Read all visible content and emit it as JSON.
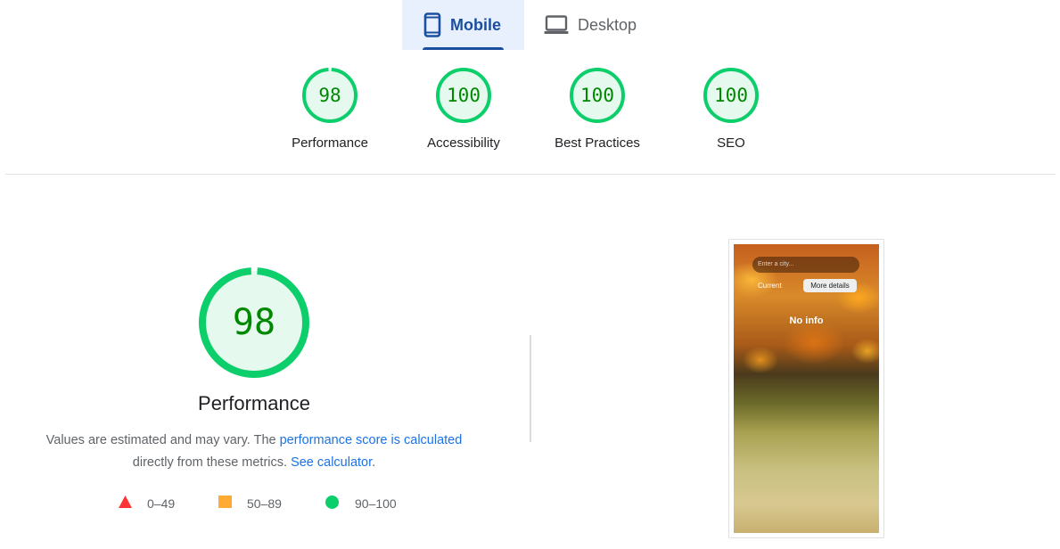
{
  "tabs": [
    {
      "label": "Mobile",
      "icon": "phone-icon",
      "active": true
    },
    {
      "label": "Desktop",
      "icon": "laptop-icon",
      "active": false
    }
  ],
  "categories": [
    {
      "score": "98",
      "label": "Performance",
      "fraction": 0.98
    },
    {
      "score": "100",
      "label": "Accessibility",
      "fraction": 1.0
    },
    {
      "score": "100",
      "label": "Best Practices",
      "fraction": 1.0
    },
    {
      "score": "100",
      "label": "SEO",
      "fraction": 1.0
    }
  ],
  "performance": {
    "score": "98",
    "fraction": 0.98,
    "title": "Performance",
    "desc_part1": "Values are estimated and may vary. The ",
    "desc_link1": "performance score is calculated",
    "desc_part2": "directly from these metrics. ",
    "desc_link2": "See calculator",
    "desc_part3": "."
  },
  "legend": [
    {
      "range": "0–49",
      "shape": "triangle",
      "color": "#ff3333"
    },
    {
      "range": "50–89",
      "shape": "square",
      "color": "#ffaa33"
    },
    {
      "range": "90–100",
      "shape": "circle",
      "color": "#0cce6b"
    }
  ],
  "colors": {
    "pass": "#0cce6b",
    "pass_text": "#008800",
    "pass_bg": "#e6f9ef",
    "accent": "#1a4fa0",
    "link": "#1a73e8"
  },
  "screenshot": {
    "input_placeholder": "Enter a city...",
    "current_label": "Current",
    "more_label": "More details",
    "status": "No info"
  }
}
